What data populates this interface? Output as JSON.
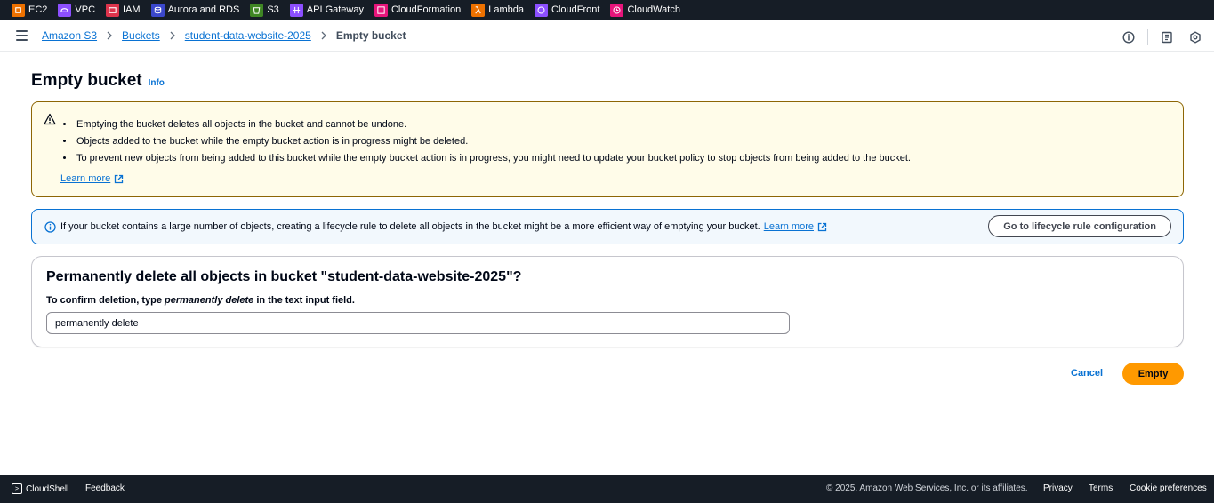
{
  "services": [
    {
      "label": "EC2",
      "icon": "ec2-icon",
      "color": "#ed7100"
    },
    {
      "label": "VPC",
      "icon": "vpc-icon",
      "color": "#8c4fff"
    },
    {
      "label": "IAM",
      "icon": "iam-icon",
      "color": "#dd344c"
    },
    {
      "label": "Aurora and RDS",
      "icon": "rds-icon",
      "color": "#3b48cc"
    },
    {
      "label": "S3",
      "icon": "s3-icon",
      "color": "#3f8624"
    },
    {
      "label": "API Gateway",
      "icon": "api-gateway-icon",
      "color": "#8c4fff"
    },
    {
      "label": "CloudFormation",
      "icon": "cloudformation-icon",
      "color": "#e7157b"
    },
    {
      "label": "Lambda",
      "icon": "lambda-icon",
      "color": "#ed7100"
    },
    {
      "label": "CloudFront",
      "icon": "cloudfront-icon",
      "color": "#8c4fff"
    },
    {
      "label": "CloudWatch",
      "icon": "cloudwatch-icon",
      "color": "#e7157b"
    }
  ],
  "breadcrumb": {
    "items": [
      "Amazon S3",
      "Buckets",
      "student-data-website-2025"
    ],
    "current": "Empty bucket"
  },
  "page": {
    "title": "Empty bucket",
    "info_link": "Info"
  },
  "warning": {
    "items": [
      "Emptying the bucket deletes all objects in the bucket and cannot be undone.",
      "Objects added to the bucket while the empty bucket action is in progress might be deleted.",
      "To prevent new objects from being added to this bucket while the empty bucket action is in progress, you might need to update your bucket policy to stop objects from being added to the bucket."
    ],
    "learn_more": "Learn more"
  },
  "info_alert": {
    "text": "If your bucket contains a large number of objects, creating a lifecycle rule to delete all objects in the bucket might be a more efficient way of emptying your bucket.",
    "learn_more": "Learn more",
    "button": "Go to lifecycle rule configuration"
  },
  "confirm": {
    "heading": "Permanently delete all objects in bucket \"student-data-website-2025\"?",
    "label_prefix": "To confirm deletion, type ",
    "label_em": "permanently delete",
    "label_suffix": " in the text input field.",
    "input_value": "permanently delete"
  },
  "actions": {
    "cancel": "Cancel",
    "empty": "Empty"
  },
  "footer": {
    "cloudshell": "CloudShell",
    "feedback": "Feedback",
    "copyright": "© 2025, Amazon Web Services, Inc. or its affiliates.",
    "privacy": "Privacy",
    "terms": "Terms",
    "cookie": "Cookie preferences"
  },
  "colors": {
    "accent": "#0972d3",
    "primary_button": "#ff9900",
    "warning_bg": "#fffce9",
    "info_bg": "#f2f8fd",
    "nav_bg": "#161d26"
  }
}
